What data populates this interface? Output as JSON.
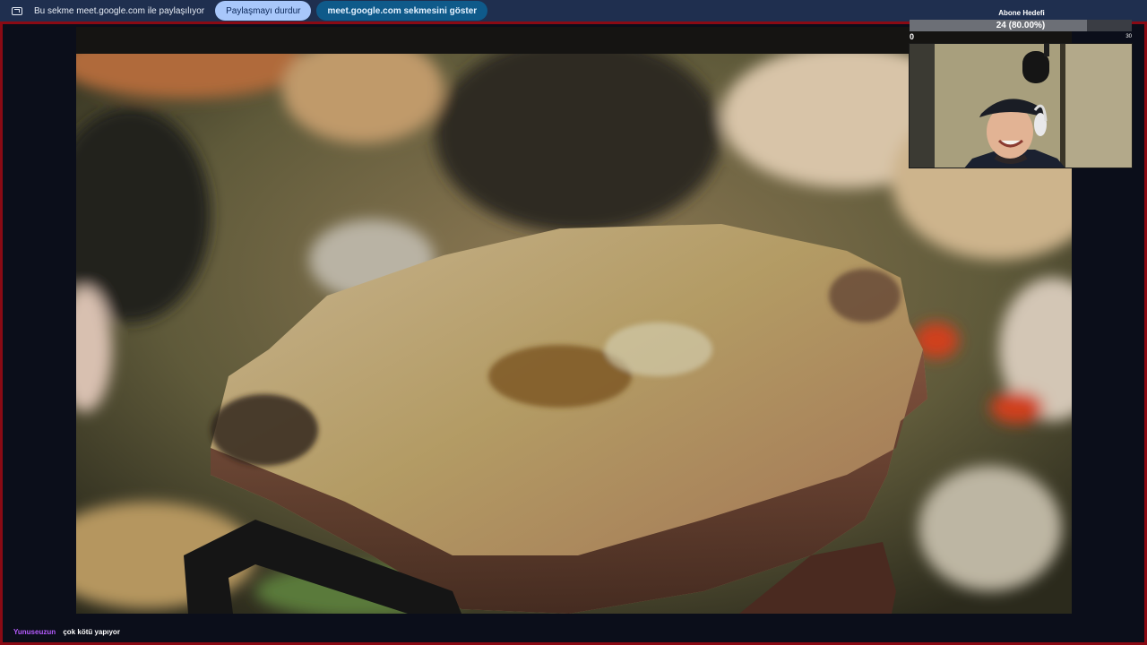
{
  "share_bar": {
    "message": "Bu sekme meet.google.com ile paylaşılıyor",
    "stop_label": "Paylaşmayı durdur",
    "show_tab_label": "meet.google.com sekmesini göster",
    "icon": "screen-share-icon"
  },
  "goal": {
    "title": "Abone Hedefi",
    "current": 24,
    "target": 30,
    "value_text": "24 (80.00%)",
    "percent": 80,
    "min_label": "0",
    "max_label": "30"
  },
  "chat": {
    "username": "Yunuseuzun",
    "message": "çok kötü yapıyor",
    "username_color": "#b65cff"
  },
  "colors": {
    "frame_border": "#8a0a14",
    "share_bar_bg": "#1f2f4f",
    "stop_button_bg": "#a8c7fa",
    "show_tab_button_bg": "#0f5a8a"
  }
}
